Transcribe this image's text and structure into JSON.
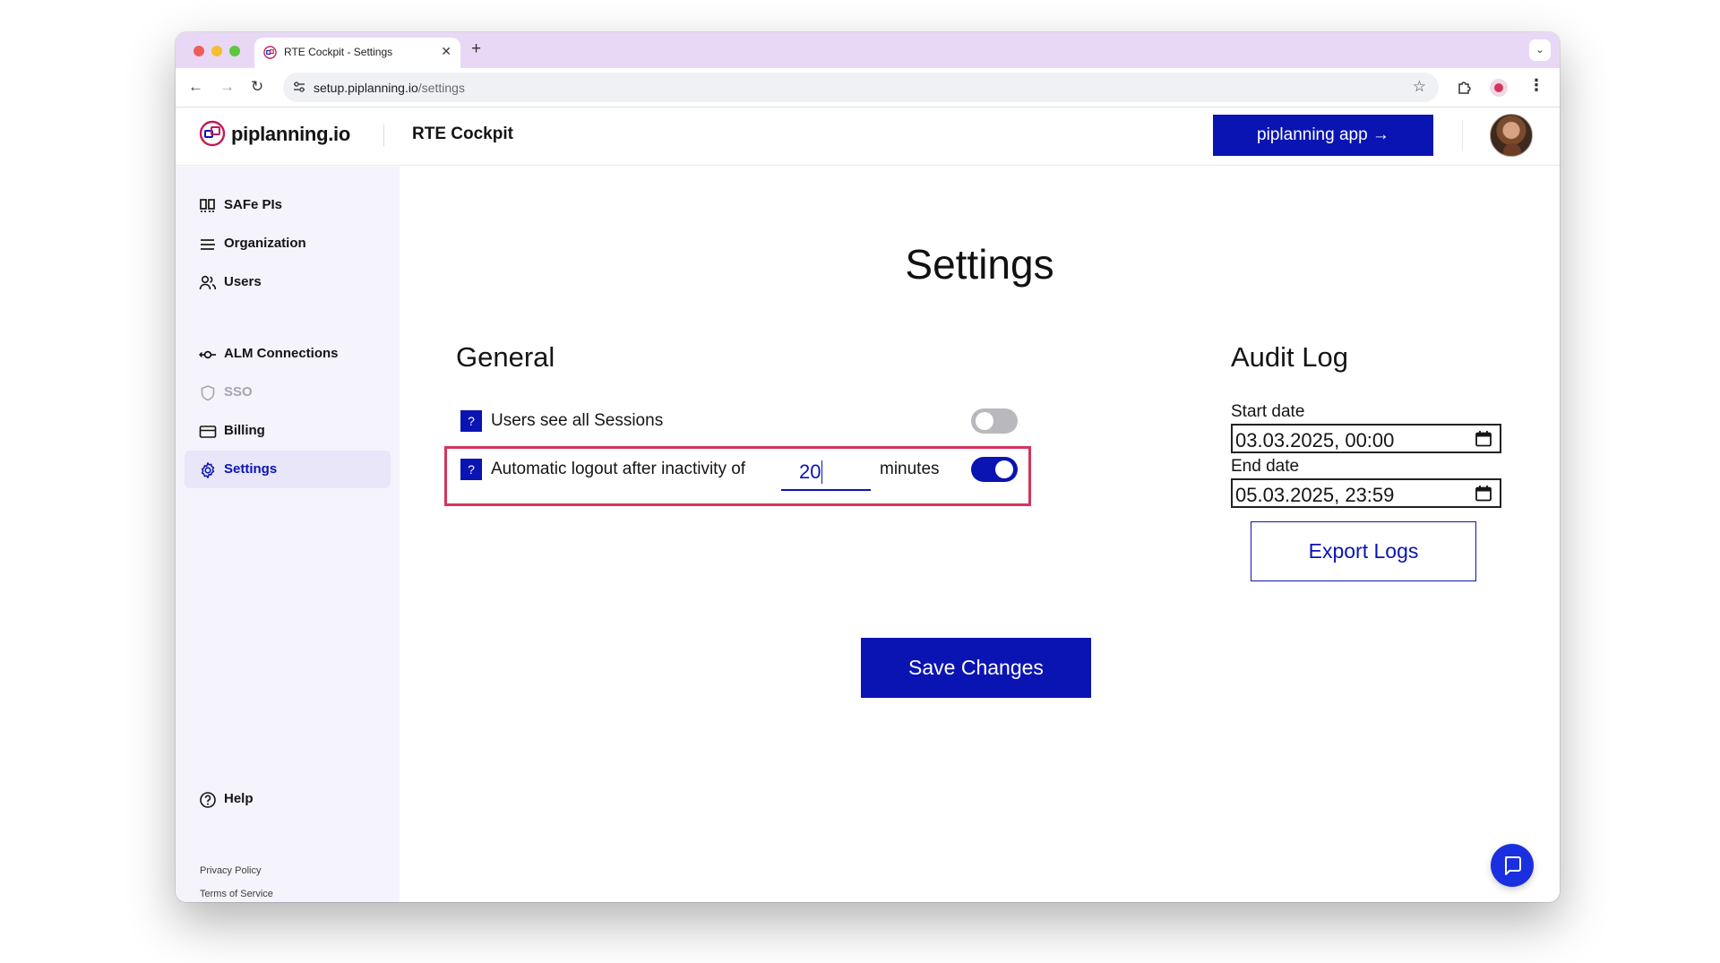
{
  "browser": {
    "tab_title": "RTE Cockpit - Settings",
    "tab_close": "✕",
    "new_tab": "+",
    "tab_menu": "⌄",
    "url_host": "setup.piplanning.io",
    "url_path": "/settings",
    "back": "←",
    "forward": "→",
    "reload": "↻",
    "bookmark": "☆",
    "menu": "⋮"
  },
  "header": {
    "logo_text": "piplanning.io",
    "title": "RTE Cockpit",
    "app_button": "piplanning app →"
  },
  "sidebar": {
    "items": [
      {
        "label": "SAFe PIs",
        "icon": "columns-icon"
      },
      {
        "label": "Organization",
        "icon": "lines-icon"
      },
      {
        "label": "Users",
        "icon": "users-icon"
      },
      {
        "label": "ALM Connections",
        "icon": "connection-icon"
      },
      {
        "label": "SSO",
        "icon": "shield-icon"
      },
      {
        "label": "Billing",
        "icon": "card-icon"
      },
      {
        "label": "Settings",
        "icon": "gear-icon"
      }
    ],
    "active": "Settings",
    "help": "Help",
    "privacy": "Privacy Policy",
    "terms": "Terms of Service"
  },
  "main": {
    "title": "Settings",
    "general": {
      "title": "General",
      "help_badge": "?",
      "sessions_label": "Users see all Sessions",
      "sessions_enabled": false,
      "logout_label": "Automatic logout after inactivity of",
      "logout_minutes": "20",
      "minutes_label": "minutes",
      "logout_enabled": true
    },
    "audit": {
      "title": "Audit Log",
      "start_label": "Start date",
      "start_value": "03.03.2025, 00:00",
      "end_label": "End date",
      "end_value": "05.03.2025, 23:59",
      "export_button": "Export Logs"
    },
    "save_button": "Save Changes"
  },
  "colors": {
    "brand": "#0a14b3",
    "highlight": "#d6335b",
    "sidebar_bg": "#f5f3fc",
    "tabstrip_bg": "#e8d8f5"
  }
}
